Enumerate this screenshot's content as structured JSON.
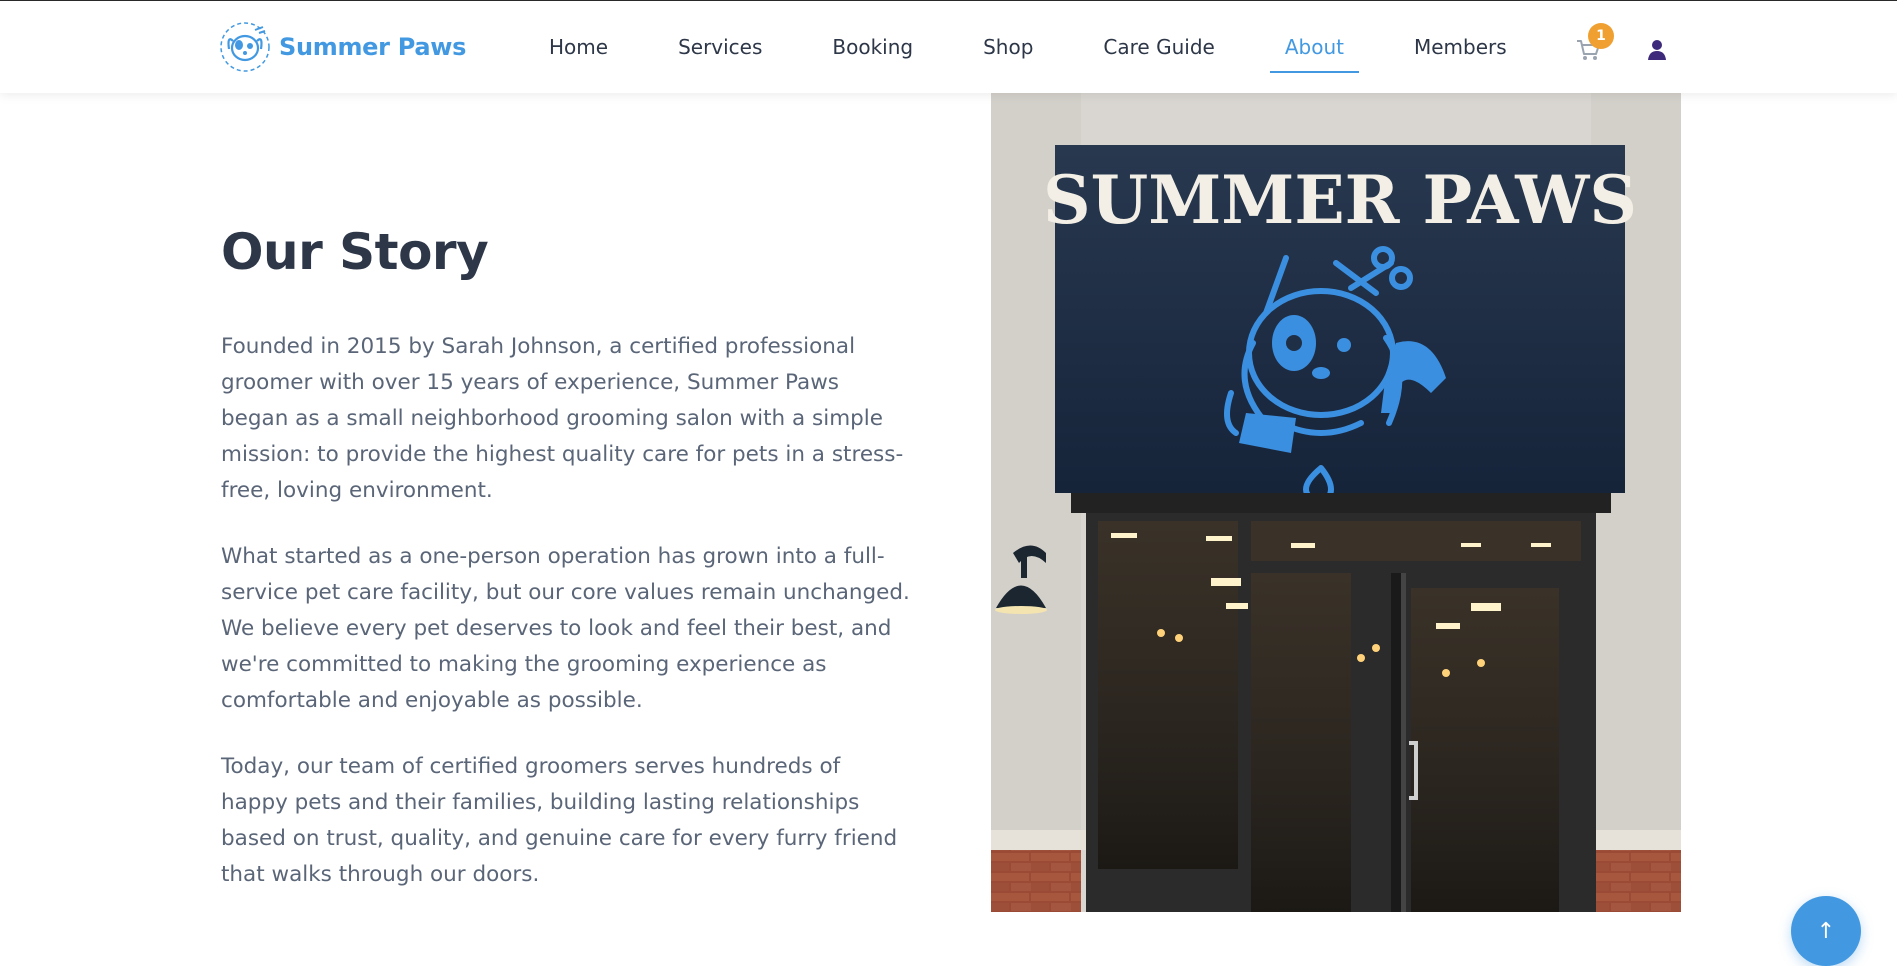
{
  "brand": {
    "name": "Summer Paws",
    "accent_color": "#4299e1",
    "logo_icon": "dog-grooming-logo-icon"
  },
  "nav": {
    "items": [
      {
        "label": "Home"
      },
      {
        "label": "Services"
      },
      {
        "label": "Booking"
      },
      {
        "label": "Shop"
      },
      {
        "label": "Care Guide"
      },
      {
        "label": "About",
        "active": true
      },
      {
        "label": "Members"
      }
    ]
  },
  "header_actions": {
    "cart_icon": "shopping-cart-icon",
    "cart_count": "1",
    "user_icon": "user-icon"
  },
  "story": {
    "title": "Our Story",
    "paragraphs": [
      "Founded in 2015 by Sarah Johnson, a certified professional groomer with over 15 years of experience, Summer Paws began as a small neighborhood grooming salon with a simple mission: to provide the highest quality care for pets in a stress-free, loving environment.",
      "What started as a one-person operation has grown into a full-service pet care facility, but our core values remain unchanged. We believe every pet deserves to look and feel their best, and we're committed to making the grooming experience as comfortable and enjoyable as possible.",
      "Today, our team of certified groomers serves hundreds of happy pets and their families, building lasting relationships based on trust, quality, and genuine care for every furry friend that walks through our doors."
    ]
  },
  "storefront": {
    "sign_text": "SUMMER PAWS",
    "sign_color": "#1f2f46",
    "logo_color": "#3b8fe0"
  },
  "scroll_top": {
    "label": "↑"
  }
}
